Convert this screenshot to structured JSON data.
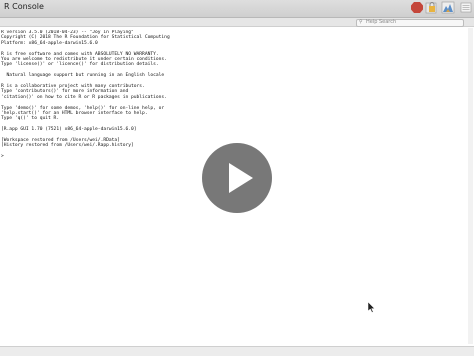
{
  "window": {
    "title": "R Console"
  },
  "toolbar": {
    "status": "",
    "search_placeholder": "Help Search",
    "icons": [
      "stop-icon",
      "lock-icon",
      "color-chart-icon",
      "list-icon"
    ]
  },
  "console": {
    "lines": [
      "R version 3.5.0 (2018-04-23) -- \"Joy in Playing\"",
      "Copyright (C) 2018 The R Foundation for Statistical Computing",
      "Platform: x86_64-apple-darwin15.6.0",
      "",
      "R is free software and comes with ABSOLUTELY NO WARRANTY.",
      "You are welcome to redistribute it under certain conditions.",
      "Type 'license()' or 'licence()' for distribution details.",
      "",
      "  Natural language support but running in an English locale",
      "",
      "R is a collaborative project with many contributors.",
      "Type 'contributors()' for more information and",
      "'citation()' on how to cite R or R packages in publications.",
      "",
      "Type 'demo()' for some demos, 'help()' for on-line help, or",
      "'help.start()' for an HTML browser interface to help.",
      "Type 'q()' to quit R.",
      "",
      "[R.app GUI 1.70 (7521) x86_64-apple-darwin15.6.0]",
      "",
      "[Workspace restored from /Users/wei/.RData]",
      "[History restored from /Users/wei/.Rapp.history]",
      "",
      ">"
    ]
  },
  "colors": {
    "stop": "#c4463a",
    "lock": "#e8b340",
    "chart": "#5b8ec8",
    "play_overlay": "#5a5a5a"
  }
}
